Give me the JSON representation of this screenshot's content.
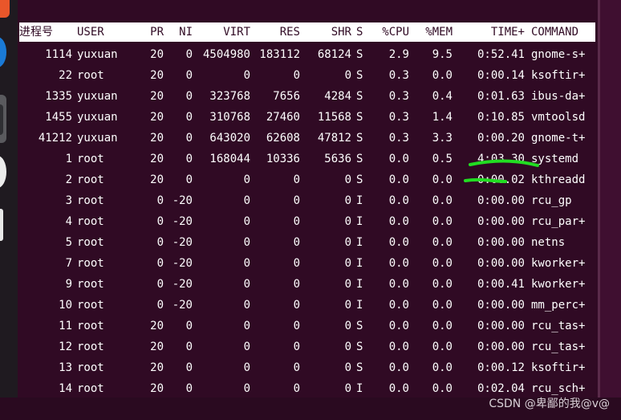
{
  "colors": {
    "terminal_bg": "#300a24",
    "header_bg": "#ffffff",
    "text": "#ffffff",
    "annotation": "#22dd22"
  },
  "dock": {
    "icons": [
      "app-icon-orange",
      "app-icon-blue",
      "app-icon-active",
      "app-icon-white",
      "app-icon-white-rect"
    ]
  },
  "table": {
    "headers": {
      "pid": "进程号",
      "user": "USER",
      "pr": "PR",
      "ni": "NI",
      "virt": "VIRT",
      "res": "RES",
      "shr": "SHR",
      "s": "S",
      "cpu": "%CPU",
      "mem": "%MEM",
      "time": "TIME+",
      "command": "COMMAND"
    },
    "rows": [
      {
        "pid": "1114",
        "user": "yuxuan",
        "pr": "20",
        "ni": "0",
        "virt": "4504980",
        "res": "183112",
        "shr": "68124",
        "s": "S",
        "cpu": "2.9",
        "mem": "9.5",
        "time": "0:52.41",
        "command": "gnome-s+"
      },
      {
        "pid": "22",
        "user": "root",
        "pr": "20",
        "ni": "0",
        "virt": "0",
        "res": "0",
        "shr": "0",
        "s": "S",
        "cpu": "0.3",
        "mem": "0.0",
        "time": "0:00.14",
        "command": "ksoftir+"
      },
      {
        "pid": "1335",
        "user": "yuxuan",
        "pr": "20",
        "ni": "0",
        "virt": "323768",
        "res": "7656",
        "shr": "4284",
        "s": "S",
        "cpu": "0.3",
        "mem": "0.4",
        "time": "0:01.63",
        "command": "ibus-da+"
      },
      {
        "pid": "1455",
        "user": "yuxuan",
        "pr": "20",
        "ni": "0",
        "virt": "310768",
        "res": "27460",
        "shr": "11568",
        "s": "S",
        "cpu": "0.3",
        "mem": "1.4",
        "time": "0:10.85",
        "command": "vmtoolsd"
      },
      {
        "pid": "41212",
        "user": "yuxuan",
        "pr": "20",
        "ni": "0",
        "virt": "643020",
        "res": "62608",
        "shr": "47812",
        "s": "S",
        "cpu": "0.3",
        "mem": "3.3",
        "time": "0:00.20",
        "command": "gnome-t+"
      },
      {
        "pid": "1",
        "user": "root",
        "pr": "20",
        "ni": "0",
        "virt": "168044",
        "res": "10336",
        "shr": "5636",
        "s": "S",
        "cpu": "0.0",
        "mem": "0.5",
        "time": "4:03.30",
        "command": "systemd"
      },
      {
        "pid": "2",
        "user": "root",
        "pr": "20",
        "ni": "0",
        "virt": "0",
        "res": "0",
        "shr": "0",
        "s": "S",
        "cpu": "0.0",
        "mem": "0.0",
        "time": "0:00.02",
        "command": "kthreadd"
      },
      {
        "pid": "3",
        "user": "root",
        "pr": "0",
        "ni": "-20",
        "virt": "0",
        "res": "0",
        "shr": "0",
        "s": "I",
        "cpu": "0.0",
        "mem": "0.0",
        "time": "0:00.00",
        "command": "rcu_gp"
      },
      {
        "pid": "4",
        "user": "root",
        "pr": "0",
        "ni": "-20",
        "virt": "0",
        "res": "0",
        "shr": "0",
        "s": "I",
        "cpu": "0.0",
        "mem": "0.0",
        "time": "0:00.00",
        "command": "rcu_par+"
      },
      {
        "pid": "5",
        "user": "root",
        "pr": "0",
        "ni": "-20",
        "virt": "0",
        "res": "0",
        "shr": "0",
        "s": "I",
        "cpu": "0.0",
        "mem": "0.0",
        "time": "0:00.00",
        "command": "netns"
      },
      {
        "pid": "7",
        "user": "root",
        "pr": "0",
        "ni": "-20",
        "virt": "0",
        "res": "0",
        "shr": "0",
        "s": "I",
        "cpu": "0.0",
        "mem": "0.0",
        "time": "0:00.00",
        "command": "kworker+"
      },
      {
        "pid": "9",
        "user": "root",
        "pr": "0",
        "ni": "-20",
        "virt": "0",
        "res": "0",
        "shr": "0",
        "s": "I",
        "cpu": "0.0",
        "mem": "0.0",
        "time": "0:00.41",
        "command": "kworker+"
      },
      {
        "pid": "10",
        "user": "root",
        "pr": "0",
        "ni": "-20",
        "virt": "0",
        "res": "0",
        "shr": "0",
        "s": "I",
        "cpu": "0.0",
        "mem": "0.0",
        "time": "0:00.00",
        "command": "mm_perc+"
      },
      {
        "pid": "11",
        "user": "root",
        "pr": "20",
        "ni": "0",
        "virt": "0",
        "res": "0",
        "shr": "0",
        "s": "S",
        "cpu": "0.0",
        "mem": "0.0",
        "time": "0:00.00",
        "command": "rcu_tas+"
      },
      {
        "pid": "12",
        "user": "root",
        "pr": "20",
        "ni": "0",
        "virt": "0",
        "res": "0",
        "shr": "0",
        "s": "S",
        "cpu": "0.0",
        "mem": "0.0",
        "time": "0:00.00",
        "command": "rcu_tas+"
      },
      {
        "pid": "13",
        "user": "root",
        "pr": "20",
        "ni": "0",
        "virt": "0",
        "res": "0",
        "shr": "0",
        "s": "S",
        "cpu": "0.0",
        "mem": "0.0",
        "time": "0:00.12",
        "command": "ksoftir+"
      },
      {
        "pid": "14",
        "user": "root",
        "pr": "20",
        "ni": "0",
        "virt": "0",
        "res": "0",
        "shr": "0",
        "s": "I",
        "cpu": "0.0",
        "mem": "0.0",
        "time": "0:02.04",
        "command": "rcu_sch+"
      }
    ]
  },
  "watermark": "CSDN @卑鄙的我@v@"
}
